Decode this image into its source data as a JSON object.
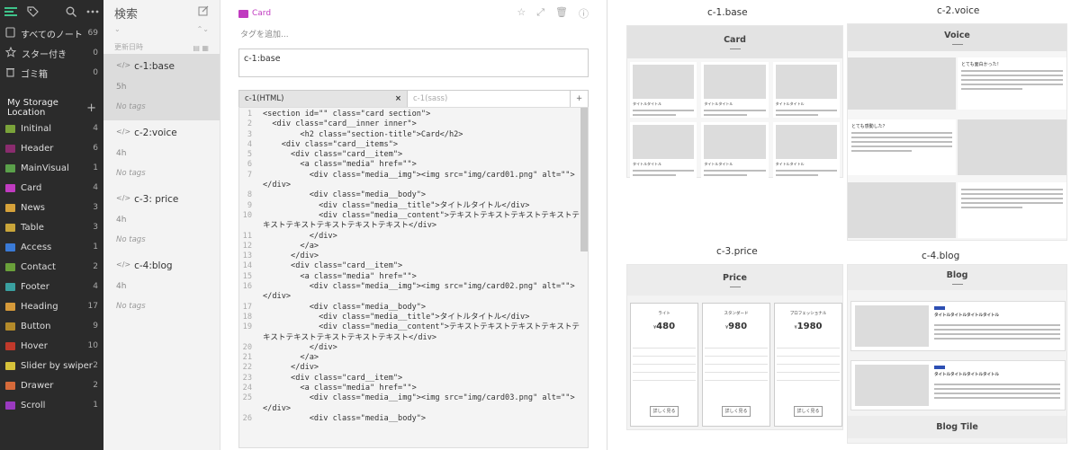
{
  "sidebar": {
    "nav": [
      {
        "label": "すべてのノート",
        "count": "69",
        "icon": "notes-icon"
      },
      {
        "label": "スター付き",
        "count": "0",
        "icon": "star-icon"
      },
      {
        "label": "ゴミ箱",
        "count": "0",
        "icon": "trash-icon"
      }
    ],
    "storage_label": "My Storage Location",
    "folders": [
      {
        "label": "Initinal",
        "count": "4",
        "color": "#7aa33a"
      },
      {
        "label": "Header",
        "count": "6",
        "color": "#8a2c6e"
      },
      {
        "label": "MainVisual",
        "count": "1",
        "color": "#5aa04a"
      },
      {
        "label": "Card",
        "count": "4",
        "color": "#c03bc0"
      },
      {
        "label": "News",
        "count": "3",
        "color": "#d6a23a"
      },
      {
        "label": "Table",
        "count": "3",
        "color": "#c9a53a"
      },
      {
        "label": "Access",
        "count": "1",
        "color": "#3a7ad6"
      },
      {
        "label": "Contact",
        "count": "2",
        "color": "#6aa03a"
      },
      {
        "label": "Footer",
        "count": "4",
        "color": "#3aa0a0"
      },
      {
        "label": "Heading",
        "count": "17",
        "color": "#d69a3a"
      },
      {
        "label": "Button",
        "count": "9",
        "color": "#b38a2a"
      },
      {
        "label": "Hover",
        "count": "10",
        "color": "#c0392b"
      },
      {
        "label": "Slider by swiper",
        "count": "2",
        "color": "#d6c23a"
      },
      {
        "label": "Drawer",
        "count": "2",
        "color": "#d66a3a"
      },
      {
        "label": "Scroll",
        "count": "1",
        "color": "#9a3ac0"
      }
    ]
  },
  "notes_list": {
    "search_label": "検索",
    "sort_label": "更新日時",
    "notes": [
      {
        "title": "c-1:base",
        "time": "5h",
        "tags": "No tags",
        "active": true
      },
      {
        "title": "c-2:voice",
        "time": "4h",
        "tags": "No tags",
        "active": false
      },
      {
        "title": "c-3: price",
        "time": "4h",
        "tags": "No tags",
        "active": false
      },
      {
        "title": "c-4:blog",
        "time": "4h",
        "tags": "No tags",
        "active": false
      }
    ]
  },
  "editor": {
    "folder": "Card",
    "tag_placeholder": "タグを追加...",
    "title": "c-1:base",
    "tab_active": "c-1(HTML)",
    "tab_inactive": "c-1(sass)",
    "code_lines": [
      {
        "n": "1",
        "t": "<section id=\"\" class=\"card section\">"
      },
      {
        "n": "2",
        "t": "  <div class=\"card__inner inner\">"
      },
      {
        "n": "3",
        "t": "        <h2 class=\"section-title\">Card</h2>"
      },
      {
        "n": "4",
        "t": "    <div class=\"card__items\">"
      },
      {
        "n": "5",
        "t": "      <div class=\"card__item\">"
      },
      {
        "n": "6",
        "t": "        <a class=\"media\" href=\"\">"
      },
      {
        "n": "7",
        "t": "          <div class=\"media__img\"><img src=\"img/card01.png\" alt=\"\">"
      },
      {
        "n": "",
        "t": "</div>"
      },
      {
        "n": "8",
        "t": "          <div class=\"media__body\">"
      },
      {
        "n": "9",
        "t": "            <div class=\"media__title\">タイトルタイトル</div>"
      },
      {
        "n": "10",
        "t": "            <div class=\"media__content\">テキストテキストテキストテキストテ"
      },
      {
        "n": "",
        "t": "キストテキストテキストテキストテキスト</div>"
      },
      {
        "n": "11",
        "t": "          </div>"
      },
      {
        "n": "12",
        "t": "        </a>"
      },
      {
        "n": "13",
        "t": "      </div>"
      },
      {
        "n": "14",
        "t": "      <div class=\"card__item\">"
      },
      {
        "n": "15",
        "t": "        <a class=\"media\" href=\"\">"
      },
      {
        "n": "16",
        "t": "          <div class=\"media__img\"><img src=\"img/card02.png\" alt=\"\">"
      },
      {
        "n": "",
        "t": "</div>"
      },
      {
        "n": "17",
        "t": "          <div class=\"media__body\">"
      },
      {
        "n": "18",
        "t": "            <div class=\"media__title\">タイトルタイトル</div>"
      },
      {
        "n": "19",
        "t": "            <div class=\"media__content\">テキストテキストテキストテキストテ"
      },
      {
        "n": "",
        "t": "キストテキストテキストテキストテキスト</div>"
      },
      {
        "n": "20",
        "t": "          </div>"
      },
      {
        "n": "21",
        "t": "        </a>"
      },
      {
        "n": "22",
        "t": "      </div>"
      },
      {
        "n": "23",
        "t": "      <div class=\"card__item\">"
      },
      {
        "n": "24",
        "t": "        <a class=\"media\" href=\"\">"
      },
      {
        "n": "25",
        "t": "          <div class=\"media__img\"><img src=\"img/card03.png\" alt=\"\">"
      },
      {
        "n": "",
        "t": "</div>"
      },
      {
        "n": "26",
        "t": "          <div class=\"media__body\">"
      }
    ]
  },
  "preview": {
    "captions": {
      "c1": "c-1.base",
      "c2": "c-2.voice",
      "c3": "c-3.price",
      "c4": "c-4.blog"
    },
    "headings": {
      "card": "Card",
      "voice": "Voice",
      "price": "Price",
      "blog": "Blog",
      "blog_tile": "Blog Tile"
    },
    "card_title": "タイトルタイトル",
    "voice_title": "とても面白かった！",
    "voice_title2": "とても感動した？",
    "price_plans": [
      {
        "name": "ライト",
        "price": "480"
      },
      {
        "name": "スタンダード",
        "price": "980"
      },
      {
        "name": "プロフェッショナル",
        "price": "1980"
      }
    ],
    "price_button": "詳しく見る",
    "blog_title": "タイトルタイトルタイトルタイトル"
  }
}
